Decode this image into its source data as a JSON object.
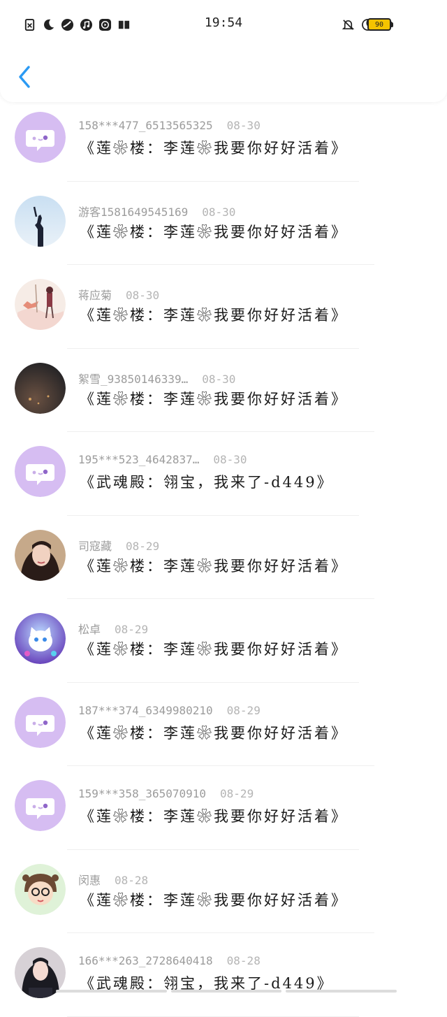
{
  "status_bar": {
    "time": "19:54",
    "battery": "90",
    "left_icons": [
      "sim-off-icon",
      "moon-icon",
      "shoe-icon",
      "music-icon",
      "video-icon",
      "book-icon"
    ],
    "right_icons": [
      "bell-off-icon",
      "moon-icon",
      "wifi-icon"
    ]
  },
  "header": {
    "back_icon": "chevron-left-icon",
    "accent": "#2b9af3"
  },
  "list": [
    {
      "name": "158***477_6513565325",
      "date": "08-30",
      "message": "《莲❀楼：李莲❀我要你好好活着》",
      "avatar": "default"
    },
    {
      "name": "游客1581649545169",
      "date": "08-30",
      "message": "《莲❀楼：李莲❀我要你好好活着》",
      "avatar": "silhouette"
    },
    {
      "name": "蒋应菊",
      "date": "08-30",
      "message": "《莲❀楼：李莲❀我要你好好活着》",
      "avatar": "illustration"
    },
    {
      "name": "絮雪_93850146339…",
      "date": "08-30",
      "message": "《莲❀楼：李莲❀我要你好好活着》",
      "avatar": "dark"
    },
    {
      "name": "195***523_4642837…",
      "date": "08-30",
      "message": "《武魂殿：翎宝，我来了-d449》",
      "avatar": "default"
    },
    {
      "name": "司寇藏",
      "date": "08-29",
      "message": "《莲❀楼：李莲❀我要你好好活着》",
      "avatar": "portrait"
    },
    {
      "name": "松卓",
      "date": "08-29",
      "message": "《莲❀楼：李莲❀我要你好好活着》",
      "avatar": "cat"
    },
    {
      "name": "187***374_6349980210",
      "date": "08-29",
      "message": "《莲❀楼：李莲❀我要你好好活着》",
      "avatar": "default"
    },
    {
      "name": "159***358_365070910",
      "date": "08-29",
      "message": "《莲❀楼：李莲❀我要你好好活着》",
      "avatar": "default"
    },
    {
      "name": "闵惠",
      "date": "08-28",
      "message": "《莲❀楼：李莲❀我要你好好活着》",
      "avatar": "cartoon"
    },
    {
      "name": "166***263_2728640418",
      "date": "08-28",
      "message": "《武魂殿：翎宝，我来了-d449》",
      "avatar": "portrait2"
    }
  ]
}
